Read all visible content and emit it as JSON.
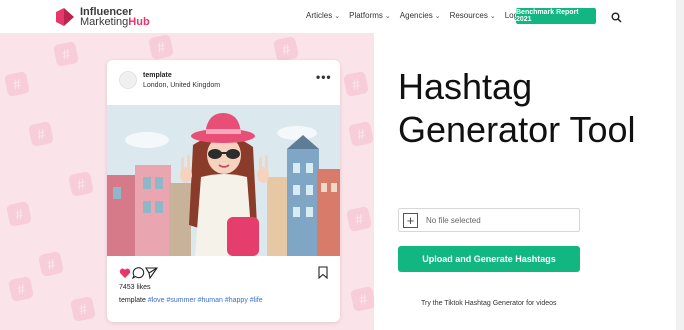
{
  "header": {
    "logo": {
      "line1": "Influencer",
      "line2_a": "Marketing",
      "line2_b": "Hub"
    },
    "nav": [
      {
        "label": "Articles",
        "dropdown": true
      },
      {
        "label": "Platforms",
        "dropdown": true
      },
      {
        "label": "Agencies",
        "dropdown": true
      },
      {
        "label": "Resources",
        "dropdown": true
      },
      {
        "label": "Login",
        "dropdown": false
      }
    ],
    "cta_label": "Benchmark Report 2021",
    "search_icon": "search-icon"
  },
  "colors": {
    "accent": "#11b681",
    "brand_pink": "#e8356b",
    "panel_bg": "#fbe3ea"
  },
  "card": {
    "username": "template",
    "location": "London, United Kingdom",
    "likes": "7453 likes",
    "caption_user": "template",
    "caption_tags": "#love #summer #human #happy #life"
  },
  "tool": {
    "title": "Hashtag Generator Tool",
    "file_placeholder": "No file selected",
    "upload_label": "Upload and Generate Hashtags",
    "tiktok_link": "Try the Tiktok Hashtag Generator for videos"
  }
}
